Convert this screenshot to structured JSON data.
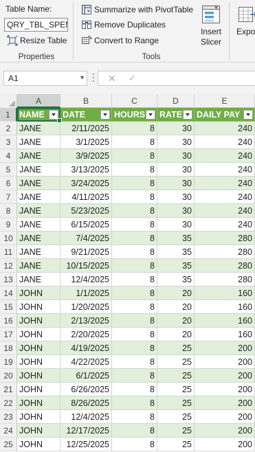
{
  "ribbon": {
    "properties": {
      "table_name_label": "Table Name:",
      "table_name_value": "QRY_TBL_SPEND",
      "resize_label": "Resize Table",
      "group_label": "Properties"
    },
    "tools": {
      "summarize_label": "Summarize with PivotTable",
      "remove_dup_label": "Remove Duplicates",
      "convert_label": "Convert to Range",
      "slicer_line1": "Insert",
      "slicer_line2": "Slicer",
      "group_label": "Tools"
    },
    "export": {
      "label": "Expo"
    }
  },
  "formula_bar": {
    "name_box": "A1",
    "formula": ""
  },
  "columns": [
    "A",
    "B",
    "C",
    "D",
    "E"
  ],
  "header": [
    "NAME",
    "DATE",
    "HOURS",
    "RATE",
    "DAILY PAY"
  ],
  "rows": [
    [
      "JANE",
      "2/11/2025",
      "8",
      "30",
      "240"
    ],
    [
      "JANE",
      "3/1/2025",
      "8",
      "30",
      "240"
    ],
    [
      "JANE",
      "3/9/2025",
      "8",
      "30",
      "240"
    ],
    [
      "JANE",
      "3/13/2025",
      "8",
      "30",
      "240"
    ],
    [
      "JANE",
      "3/24/2025",
      "8",
      "30",
      "240"
    ],
    [
      "JANE",
      "4/11/2025",
      "8",
      "30",
      "240"
    ],
    [
      "JANE",
      "5/23/2025",
      "8",
      "30",
      "240"
    ],
    [
      "JANE",
      "6/15/2025",
      "8",
      "30",
      "240"
    ],
    [
      "JANE",
      "7/4/2025",
      "8",
      "35",
      "280"
    ],
    [
      "JANE",
      "9/21/2025",
      "8",
      "35",
      "280"
    ],
    [
      "JANE",
      "10/15/2025",
      "8",
      "35",
      "280"
    ],
    [
      "JANE",
      "12/4/2025",
      "8",
      "35",
      "280"
    ],
    [
      "JOHN",
      "1/1/2025",
      "8",
      "20",
      "160"
    ],
    [
      "JOHN",
      "1/20/2025",
      "8",
      "20",
      "160"
    ],
    [
      "JOHN",
      "2/13/2025",
      "8",
      "20",
      "160"
    ],
    [
      "JOHN",
      "2/20/2025",
      "8",
      "20",
      "160"
    ],
    [
      "JOHN",
      "4/19/2025",
      "8",
      "25",
      "200"
    ],
    [
      "JOHN",
      "4/22/2025",
      "8",
      "25",
      "200"
    ],
    [
      "JOHN",
      "6/1/2025",
      "8",
      "25",
      "200"
    ],
    [
      "JOHN",
      "6/26/2025",
      "8",
      "25",
      "200"
    ],
    [
      "JOHN",
      "8/26/2025",
      "8",
      "25",
      "200"
    ],
    [
      "JOHN",
      "12/4/2025",
      "8",
      "25",
      "200"
    ],
    [
      "JOHN",
      "12/17/2025",
      "8",
      "25",
      "200"
    ],
    [
      "JOHN",
      "12/25/2025",
      "8",
      "25",
      "200"
    ]
  ],
  "colors": {
    "header_fill": "#70ad47",
    "band_fill": "#e2efda",
    "selection": "#217346"
  }
}
